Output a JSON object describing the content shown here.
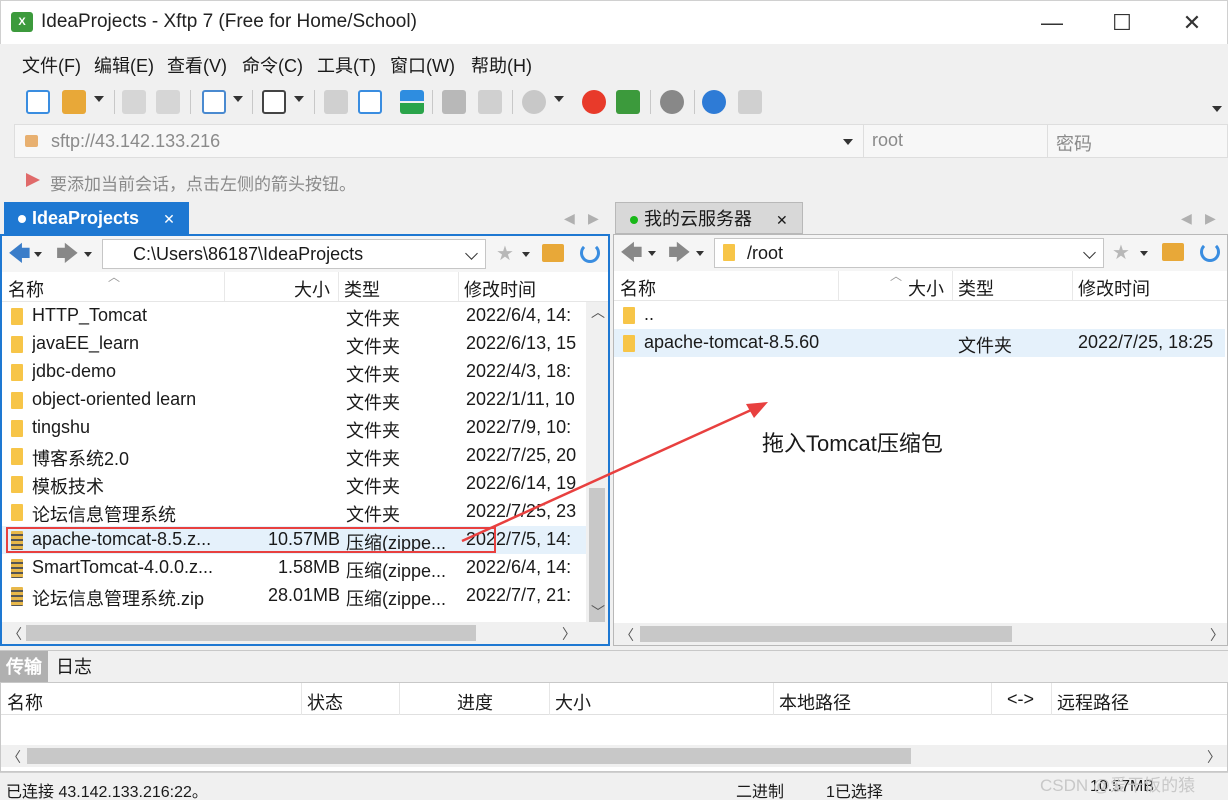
{
  "window": {
    "title": "IdeaProjects - Xftp 7 (Free for Home/School)",
    "icon_label": "X",
    "minimize": "—",
    "maximize": "☐",
    "close": "✕"
  },
  "menu": [
    "文件(F)",
    "编辑(E)",
    "查看(V)",
    "命令(C)",
    "工具(T)",
    "窗口(W)",
    "帮助(H)"
  ],
  "address": {
    "url": "sftp://43.142.133.216",
    "user_placeholder": "root",
    "pass_placeholder": "密码"
  },
  "hint": "要添加当前会话，点击左侧的箭头按钮。",
  "left_pane": {
    "tab_label": "IdeaProjects",
    "path": "C:\\Users\\86187\\IdeaProjects",
    "columns": [
      "名称",
      "大小",
      "类型",
      "修改时间"
    ],
    "rows": [
      {
        "name": "HTTP_Tomcat",
        "size": "",
        "type": "文件夹",
        "modified": "2022/6/4, 14:",
        "kind": "folder"
      },
      {
        "name": "javaEE_learn",
        "size": "",
        "type": "文件夹",
        "modified": "2022/6/13, 15",
        "kind": "folder"
      },
      {
        "name": "jdbc-demo",
        "size": "",
        "type": "文件夹",
        "modified": "2022/4/3, 18:",
        "kind": "folder"
      },
      {
        "name": "object-oriented learn",
        "size": "",
        "type": "文件夹",
        "modified": "2022/1/11, 10",
        "kind": "folder"
      },
      {
        "name": "tingshu",
        "size": "",
        "type": "文件夹",
        "modified": "2022/7/9, 10:",
        "kind": "folder"
      },
      {
        "name": "博客系统2.0",
        "size": "",
        "type": "文件夹",
        "modified": "2022/7/25, 20",
        "kind": "folder"
      },
      {
        "name": "模板技术",
        "size": "",
        "type": "文件夹",
        "modified": "2022/6/14, 19",
        "kind": "folder"
      },
      {
        "name": "论坛信息管理系统",
        "size": "",
        "type": "文件夹",
        "modified": "2022/7/25, 23",
        "kind": "folder"
      },
      {
        "name": "apache-tomcat-8.5.z...",
        "size": "10.57MB",
        "type": "压缩(zippe...",
        "modified": "2022/7/5, 14:",
        "kind": "zip",
        "selected": true
      },
      {
        "name": "SmartTomcat-4.0.0.z...",
        "size": "1.58MB",
        "type": "压缩(zippe...",
        "modified": "2022/6/4, 14:",
        "kind": "zip"
      },
      {
        "name": "论坛信息管理系统.zip",
        "size": "28.01MB",
        "type": "压缩(zippe...",
        "modified": "2022/7/7, 21:",
        "kind": "zip"
      }
    ]
  },
  "right_pane": {
    "tab_label": "我的云服务器",
    "path": "/root",
    "columns": [
      "名称",
      "大小",
      "类型",
      "修改时间"
    ],
    "rows": [
      {
        "name": "..",
        "size": "",
        "type": "",
        "modified": "",
        "kind": "folder"
      },
      {
        "name": "apache-tomcat-8.5.60",
        "size": "",
        "type": "文件夹",
        "modified": "2022/7/25, 18:25",
        "kind": "folder",
        "selected": true
      }
    ]
  },
  "annotation": {
    "text": "拖入Tomcat压缩包",
    "color": "#e8403f"
  },
  "bottom": {
    "tabs": [
      "传输",
      "日志"
    ],
    "columns": [
      "名称",
      "状态",
      "进度",
      "大小",
      "本地路径",
      "<->",
      "远程路径"
    ]
  },
  "status": {
    "connection": "已连接 43.142.133.216:22。",
    "mode": "二进制",
    "selection": "1已选择",
    "size": "10.57MB"
  },
  "watermark": "CSDN @爱干饭的猿",
  "colors": {
    "accent": "#1e78d2",
    "selection": "#e5f1fb",
    "folder": "#f7c548"
  }
}
